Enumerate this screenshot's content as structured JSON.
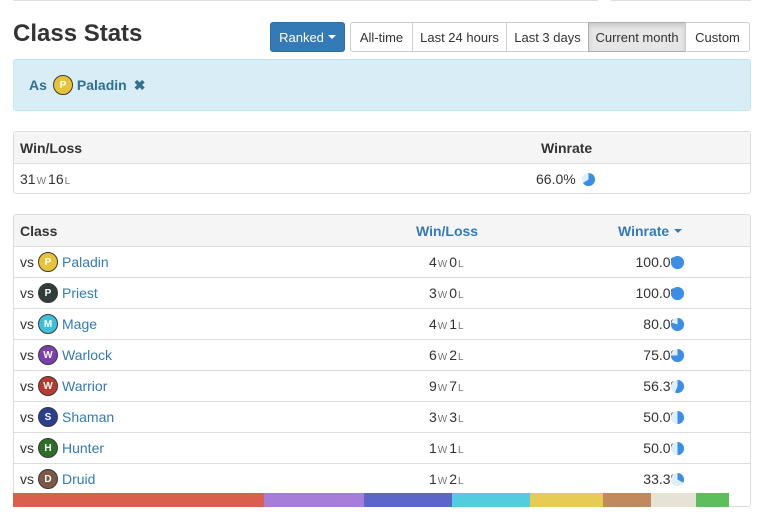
{
  "page": {
    "title": "Class Stats"
  },
  "controls": {
    "mode_label": "Ranked",
    "time_ranges": [
      {
        "label": "All-time",
        "active": false
      },
      {
        "label": "Last 24 hours",
        "active": false
      },
      {
        "label": "Last 3 days",
        "active": false
      },
      {
        "label": "Current month",
        "active": true
      },
      {
        "label": "Custom",
        "active": false
      }
    ]
  },
  "filter": {
    "prefix": "As",
    "class_name": "Paladin",
    "class_icon": "paladin-icon",
    "remove_icon": "close-icon"
  },
  "summary": {
    "headers": {
      "winloss": "Win/Loss",
      "winrate": "Winrate"
    },
    "wins": "31",
    "losses": "16",
    "win_suffix": "W",
    "loss_suffix": "L",
    "winrate_text": "66.0%",
    "winrate_fraction": 0.66
  },
  "class_table": {
    "headers": {
      "class": "Class",
      "winloss": "Win/Loss",
      "winrate": "Winrate"
    },
    "vs_label": "vs",
    "win_suffix": "W",
    "loss_suffix": "L",
    "rows": [
      {
        "class": "Paladin",
        "icon": "paladin-icon",
        "icon_color": "#e8c33a",
        "wins": "4",
        "losses": "0",
        "winrate": "100.0%",
        "fraction": 1.0
      },
      {
        "class": "Priest",
        "icon": "priest-icon",
        "icon_color": "#2f3e3a",
        "wins": "3",
        "losses": "0",
        "winrate": "100.0%",
        "fraction": 1.0
      },
      {
        "class": "Mage",
        "icon": "mage-icon",
        "icon_color": "#3ec0d6",
        "wins": "4",
        "losses": "1",
        "winrate": "80.0%",
        "fraction": 0.8
      },
      {
        "class": "Warlock",
        "icon": "warlock-icon",
        "icon_color": "#7b3fb0",
        "wins": "6",
        "losses": "2",
        "winrate": "75.0%",
        "fraction": 0.75
      },
      {
        "class": "Warrior",
        "icon": "warrior-icon",
        "icon_color": "#b83a2e",
        "wins": "9",
        "losses": "7",
        "winrate": "56.3%",
        "fraction": 0.563
      },
      {
        "class": "Shaman",
        "icon": "shaman-icon",
        "icon_color": "#2a3f8f",
        "wins": "3",
        "losses": "3",
        "winrate": "50.0%",
        "fraction": 0.5
      },
      {
        "class": "Hunter",
        "icon": "hunter-icon",
        "icon_color": "#2f6e2a",
        "wins": "1",
        "losses": "1",
        "winrate": "50.0%",
        "fraction": 0.5
      },
      {
        "class": "Druid",
        "icon": "druid-icon",
        "icon_color": "#7a5a46",
        "wins": "1",
        "losses": "2",
        "winrate": "33.3%",
        "fraction": 0.333
      }
    ]
  },
  "distribution_bar": {
    "segments": [
      {
        "color": "#d9604c",
        "share": 0.34
      },
      {
        "color": "#a67ed9",
        "share": 0.135
      },
      {
        "color": "#5c66c9",
        "share": 0.12
      },
      {
        "color": "#55cbe0",
        "share": 0.105
      },
      {
        "color": "#e6cc55",
        "share": 0.1
      },
      {
        "color": "#c08a5c",
        "share": 0.065
      },
      {
        "color": "#e6e3d6",
        "share": 0.06
      },
      {
        "color": "#5cbf5c",
        "share": 0.045
      }
    ]
  },
  "colors": {
    "primary": "#337ab7",
    "pie": "#3a8ee6",
    "pie_bg": "#dfeefb"
  }
}
